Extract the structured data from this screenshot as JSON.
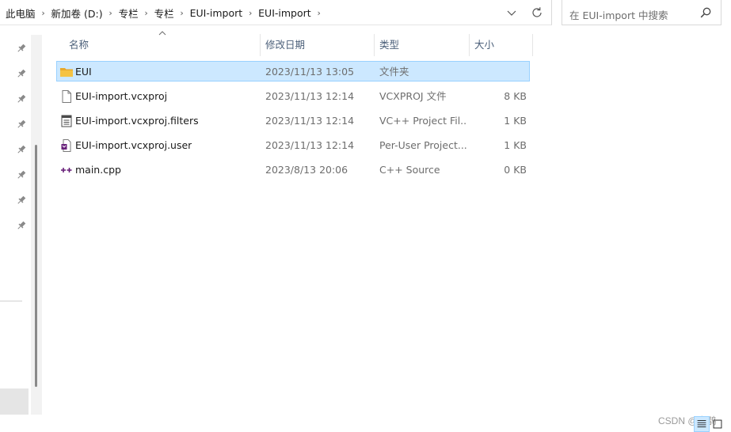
{
  "address_bar": {
    "breadcrumbs": [
      "此电脑",
      "新加卷 (D:)",
      "专栏",
      "专栏",
      "EUI-import",
      "EUI-import"
    ],
    "separator_icon": "chevron-right-icon",
    "dropdown_icon": "chevron-down-icon",
    "refresh_icon": "refresh-icon"
  },
  "search": {
    "placeholder": "在 EUI-import 中搜索",
    "icon": "search-icon"
  },
  "navigation": {
    "pinned_count": 8,
    "pin_icon": "pin-icon"
  },
  "columns": {
    "name": "名称",
    "date": "修改日期",
    "type": "类型",
    "size": "大小",
    "sort_icon": "sort-ascending-icon"
  },
  "files": [
    {
      "icon": "folder-icon",
      "name": "EUI",
      "date": "2023/11/13 13:05",
      "type": "文件夹",
      "size": "",
      "selected": true
    },
    {
      "icon": "document-icon",
      "name": "EUI-import.vcxproj",
      "date": "2023/11/13 12:14",
      "type": "VCXPROJ 文件",
      "size": "8 KB",
      "selected": false
    },
    {
      "icon": "filters-file-icon",
      "name": "EUI-import.vcxproj.filters",
      "date": "2023/11/13 12:14",
      "type": "VC++ Project Fil...",
      "size": "1 KB",
      "selected": false
    },
    {
      "icon": "vs-user-file-icon",
      "name": "EUI-import.vcxproj.user",
      "date": "2023/11/13 12:14",
      "type": "Per-User Project...",
      "size": "1 KB",
      "selected": false
    },
    {
      "icon": "cpp-file-icon",
      "name": "main.cpp",
      "date": "2023/8/13 20:06",
      "type": "C++ Source",
      "size": "0 KB",
      "selected": false
    }
  ],
  "colors": {
    "selection_fill": "#cce8ff",
    "selection_border": "#99d1ff",
    "folder": "#f5c342",
    "header_text": "#4c607a"
  },
  "watermark": "CSDN @白鹊",
  "view_toggle": {
    "details_icon": "details-view-icon",
    "tiles_icon": "large-icons-view-icon"
  }
}
